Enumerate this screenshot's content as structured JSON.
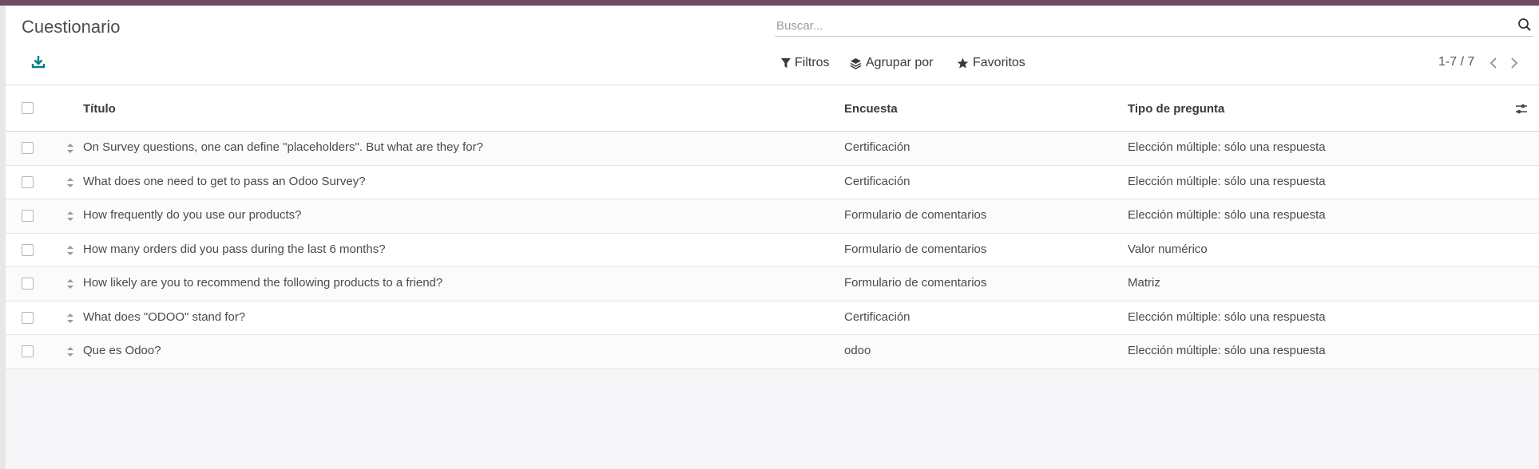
{
  "app": {
    "title": "Cuestionario"
  },
  "search": {
    "placeholder": "Buscar...",
    "value": "",
    "icon": "search-icon"
  },
  "toolbar": {
    "download_icon": "download-icon",
    "filters_label": "Filtros",
    "group_by_label": "Agrupar por",
    "favorites_label": "Favoritos"
  },
  "pager": {
    "text": "1-7 / 7"
  },
  "table": {
    "columns": [
      "Título",
      "Encuesta",
      "Tipo de pregunta"
    ],
    "rows": [
      {
        "title": "On Survey questions, one can define \"placeholders\". But what are they for?",
        "survey": "Certificación",
        "type": "Elección múltiple: sólo una respuesta"
      },
      {
        "title": "What does one need to get to pass an Odoo Survey?",
        "survey": "Certificación",
        "type": "Elección múltiple: sólo una respuesta"
      },
      {
        "title": "How frequently do you use our products?",
        "survey": "Formulario de comentarios",
        "type": "Elección múltiple: sólo una respuesta"
      },
      {
        "title": "How many orders did you pass during the last 6 months?",
        "survey": "Formulario de comentarios",
        "type": "Valor numérico"
      },
      {
        "title": "How likely are you to recommend the following products to a friend?",
        "survey": "Formulario de comentarios",
        "type": "Matriz"
      },
      {
        "title": "What does \"ODOO\" stand for?",
        "survey": "Certificación",
        "type": "Elección múltiple: sólo una respuesta"
      },
      {
        "title": "Que es Odoo?",
        "survey": "odoo",
        "type": "Elección múltiple: sólo una respuesta"
      }
    ]
  },
  "colors": {
    "brand": "#6f4b66",
    "accent": "#017e84"
  }
}
